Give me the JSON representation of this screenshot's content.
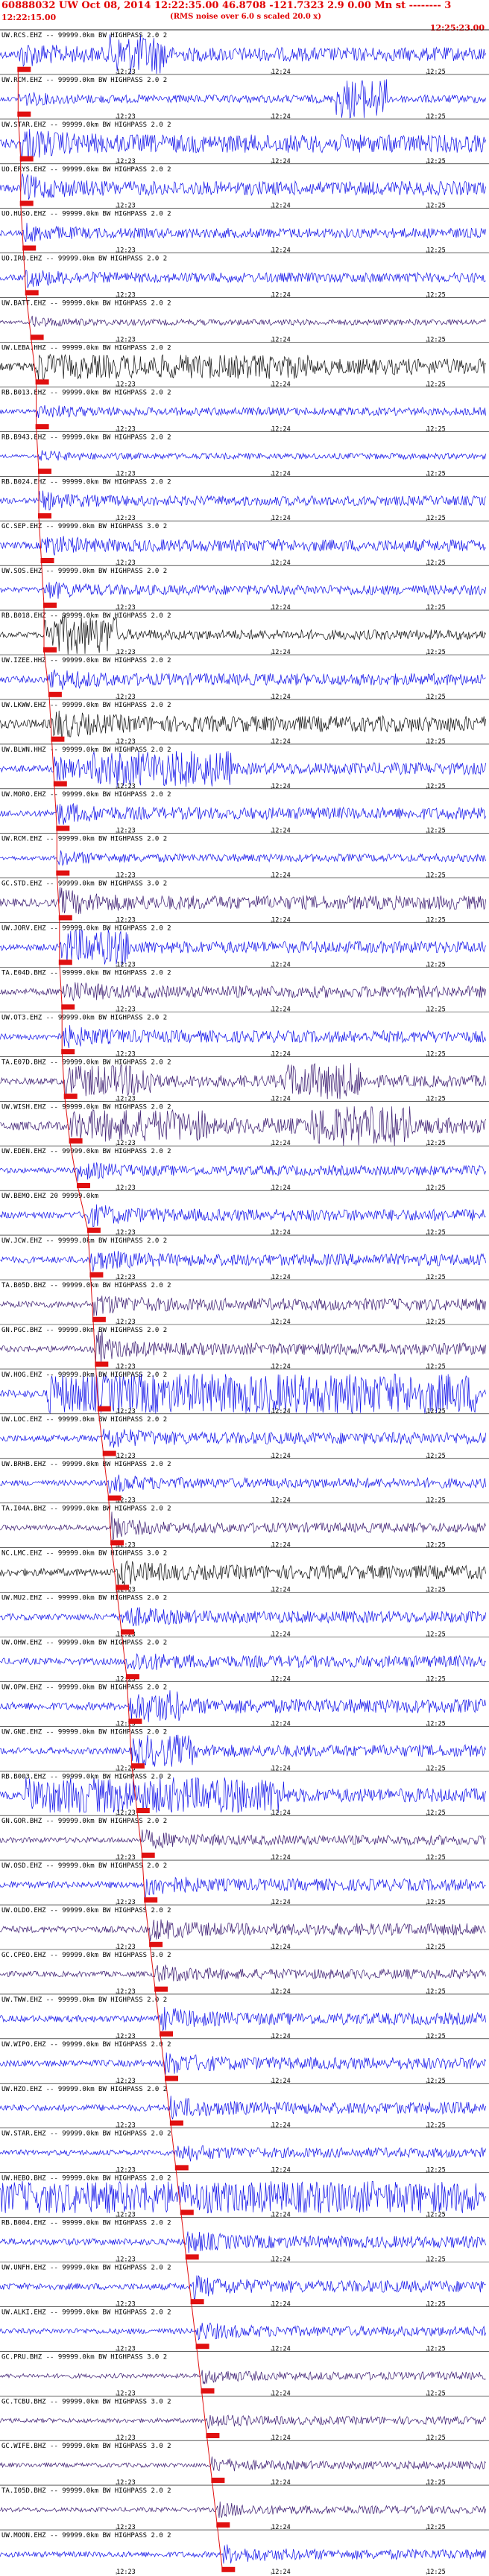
{
  "header": {
    "title": "60888032 UW Oct 08, 2014 12:22:35.00   46.8708 -121.7323  2.9 0.00 Mn st -------- 3",
    "start_time": "12:22:15.00",
    "note": "(RMS noise over 6.0 s scaled 20.0 x)",
    "end_time": "12:25:23.00"
  },
  "colors": {
    "blue": "#1010e8",
    "purple": "#3a1a70",
    "black": "#101010",
    "pick": "#e01010",
    "text": "#000000"
  },
  "chart_data": {
    "type": "line",
    "title": "60888032 UW Oct 08, 2014 12:22:35.00   46.8708 -121.7323  2.9 0.00 Mn st -------- 3",
    "x_label": "time",
    "x_start": "12:22:15.00",
    "x_end": "12:25:23.00",
    "time_ticks": [
      "12:23",
      "12:24",
      "12:25"
    ],
    "series": [
      {
        "name": "UW.RCS.EHZ -- 99999.0km BW  HIGHPASS  2.0  2",
        "color": "blue",
        "pick_s": 7,
        "amp": 0.35,
        "burst": [
          [
            42,
            65,
            1.0
          ]
        ]
      },
      {
        "name": "UW.RCM.EHZ -- 99999.0km BW  HIGHPASS  2.0  2",
        "color": "blue",
        "pick_s": 7,
        "amp": 0.2,
        "burst": [
          [
            130,
            150,
            1.0
          ]
        ]
      },
      {
        "name": "UW.STAR.EHZ -- 99999.0km BW  HIGHPASS  2.0  2",
        "color": "blue",
        "pick_s": 8,
        "amp": 0.45,
        "burst": []
      },
      {
        "name": "UO.ERYS.EHZ -- 99999.0km BW  HIGHPASS  2.0  2",
        "color": "blue",
        "pick_s": 8,
        "amp": 0.35,
        "burst": []
      },
      {
        "name": "UO.HUSO.EHZ -- 99999.0km BW  HIGHPASS  2.0  2",
        "color": "blue",
        "pick_s": 9,
        "amp": 0.25,
        "burst": []
      },
      {
        "name": "UO.IRO.EHZ -- 99999.0km BW  HIGHPASS  2.0  2",
        "color": "blue",
        "pick_s": 10,
        "amp": 0.25,
        "burst": []
      },
      {
        "name": "UW.BATT.EHZ -- 99999.0km BW  HIGHPASS  2.0  2",
        "color": "purple",
        "pick_s": 12,
        "amp": 0.15,
        "burst": []
      },
      {
        "name": "UW.LEBA.HHZ -- 99999.0km BW  HIGHPASS  2.0  2",
        "color": "black",
        "pick_s": 14,
        "amp": 0.4,
        "burst": [
          [
            15,
            120,
            0.6
          ]
        ]
      },
      {
        "name": "RB.B013.EHZ -- 99999.0km BW  HIGHPASS  2.0  2",
        "color": "blue",
        "pick_s": 14,
        "amp": 0.2,
        "burst": []
      },
      {
        "name": "RB.B943.EHZ -- 99999.0km BW  HIGHPASS  2.0  2",
        "color": "blue",
        "pick_s": 15,
        "amp": 0.15,
        "burst": []
      },
      {
        "name": "RB.B024.EHZ -- 99999.0km BW  HIGHPASS  2.0  2",
        "color": "blue",
        "pick_s": 15,
        "amp": 0.25,
        "burst": []
      },
      {
        "name": "GC.SEP.EHZ -- 99999.0km BW  HIGHPASS  3.0  2",
        "color": "blue",
        "pick_s": 16,
        "amp": 0.3,
        "burst": []
      },
      {
        "name": "UW.SOS.EHZ -- 99999.0km BW  HIGHPASS  2.0  2",
        "color": "blue",
        "pick_s": 17,
        "amp": 0.25,
        "burst": []
      },
      {
        "name": "RB.B018.EHZ -- 99999.0km BW  HIGHPASS  2.0  2",
        "color": "black",
        "pick_s": 17,
        "amp": 0.25,
        "burst": [
          [
            17,
            45,
            1.0
          ]
        ]
      },
      {
        "name": "UW.IZEE.HHZ -- 99999.0km BW  HIGHPASS  2.0  2",
        "color": "blue",
        "pick_s": 19,
        "amp": 0.3,
        "burst": []
      },
      {
        "name": "UW.LKWW.EHZ -- 99999.0km BW  HIGHPASS  2.0  2",
        "color": "black",
        "pick_s": 20,
        "amp": 0.4,
        "burst": []
      },
      {
        "name": "UW.BLWN.HHZ -- 99999.0km BW  HIGHPASS  2.0  2",
        "color": "blue",
        "pick_s": 21,
        "amp": 0.3,
        "burst": [
          [
            35,
            90,
            0.9
          ]
        ]
      },
      {
        "name": "UW.MORO.EHZ -- 99999.0km BW  HIGHPASS  2.0  2",
        "color": "blue",
        "pick_s": 22,
        "amp": 0.3,
        "burst": []
      },
      {
        "name": "UW.RCM.EHZ -- 99999.0km BW  HIGHPASS  2.0  2",
        "color": "blue",
        "pick_s": 22,
        "amp": 0.2,
        "burst": []
      },
      {
        "name": "GC.STD.EHZ -- 99999.0km BW  HIGHPASS  3.0  2",
        "color": "purple",
        "pick_s": 23,
        "amp": 0.35,
        "burst": []
      },
      {
        "name": "UW.JORV.EHZ -- 99999.0km BW  HIGHPASS  2.0  2",
        "color": "blue",
        "pick_s": 23,
        "amp": 0.3,
        "burst": [
          [
            25,
            50,
            0.9
          ]
        ]
      },
      {
        "name": "TA.E04D.BHZ -- 99999.0km BW  HIGHPASS  2.0  2",
        "color": "purple",
        "pick_s": 24,
        "amp": 0.3,
        "burst": []
      },
      {
        "name": "UW.OT3.EHZ -- 99999.0km BW  HIGHPASS  2.0  2",
        "color": "blue",
        "pick_s": 24,
        "amp": 0.3,
        "burst": []
      },
      {
        "name": "TA.E07D.BHZ -- 99999.0km BW  HIGHPASS  2.0  2",
        "color": "purple",
        "pick_s": 25,
        "amp": 0.3,
        "burst": [
          [
            25,
            60,
            0.8
          ],
          [
            110,
            140,
            0.9
          ]
        ]
      },
      {
        "name": "UW.WISH.EHZ -- 99999.0km BW  HIGHPASS  2.0  2",
        "color": "purple",
        "pick_s": 27,
        "amp": 0.4,
        "burst": [
          [
            35,
            80,
            0.8
          ],
          [
            120,
            160,
            1.0
          ]
        ]
      },
      {
        "name": "UW.EDEN.EHZ -- 99999.0km BW  HIGHPASS  2.0  2",
        "color": "blue",
        "pick_s": 30,
        "amp": 0.25,
        "burst": []
      },
      {
        "name": "UW.BEMO.EHZ 20 99999.0km",
        "color": "blue",
        "pick_s": 34,
        "amp": 0.3,
        "burst": []
      },
      {
        "name": "UW.JCW.EHZ -- 99999.0km BW  HIGHPASS  2.0  2",
        "color": "blue",
        "pick_s": 35,
        "amp": 0.3,
        "burst": []
      },
      {
        "name": "TA.B05D.BHZ -- 99999.0km BW  HIGHPASS  2.0  2",
        "color": "purple",
        "pick_s": 36,
        "amp": 0.3,
        "burst": []
      },
      {
        "name": "GN.PGC.BHZ -- 99999.0km BW  HIGHPASS  2.0  2",
        "color": "purple",
        "pick_s": 37,
        "amp": 0.3,
        "burst": [
          [
            37,
            40,
            1.0
          ]
        ]
      },
      {
        "name": "UW.HOG.EHZ -- 99999.0km BW  HIGHPASS  2.0  2",
        "color": "blue",
        "pick_s": 38,
        "amp": 0.35,
        "burst": [
          [
            18,
            185,
            1.0
          ]
        ]
      },
      {
        "name": "UW.LOC.EHZ -- 99999.0km BW  HIGHPASS  2.0  2",
        "color": "blue",
        "pick_s": 40,
        "amp": 0.3,
        "burst": []
      },
      {
        "name": "UW.BRHB.EHZ -- 99999.0km BW  HIGHPASS  2.0  2",
        "color": "blue",
        "pick_s": 42,
        "amp": 0.25,
        "burst": []
      },
      {
        "name": "TA.I04A.BHZ -- 99999.0km BW  HIGHPASS  2.0  2",
        "color": "purple",
        "pick_s": 43,
        "amp": 0.25,
        "burst": [
          [
            43,
            46,
            1.0
          ]
        ]
      },
      {
        "name": "NC.LMC.EHZ -- 99999.0km BW  HIGHPASS  3.0  2",
        "color": "black",
        "pick_s": 45,
        "amp": 0.35,
        "burst": []
      },
      {
        "name": "UW.MU2.EHZ -- 99999.0km BW  HIGHPASS  2.0  2",
        "color": "blue",
        "pick_s": 47,
        "amp": 0.3,
        "burst": []
      },
      {
        "name": "UW.OHW.EHZ -- 99999.0km BW  HIGHPASS  2.0  2",
        "color": "blue",
        "pick_s": 49,
        "amp": 0.3,
        "burst": []
      },
      {
        "name": "UW.OPW.EHZ -- 99999.0km BW  HIGHPASS  2.0  2",
        "color": "blue",
        "pick_s": 50,
        "amp": 0.35,
        "burst": [
          [
            50,
            70,
            0.8
          ]
        ]
      },
      {
        "name": "UW.GNE.EHZ -- 99999.0km BW  HIGHPASS  2.0  2",
        "color": "blue",
        "pick_s": 51,
        "amp": 0.3,
        "burst": [
          [
            51,
            75,
            0.8
          ]
        ]
      },
      {
        "name": "RB.B003.EHZ -- 99999.0km BW  HIGHPASS  2.0  2",
        "color": "blue",
        "pick_s": 53,
        "amp": 0.35,
        "burst": [
          [
            10,
            110,
            0.9
          ]
        ]
      },
      {
        "name": "GN.GOR.BHZ -- 99999.0km BW  HIGHPASS  2.0  2",
        "color": "purple",
        "pick_s": 55,
        "amp": 0.25,
        "burst": []
      },
      {
        "name": "UW.OSD.EHZ -- 99999.0km BW  HIGHPASS  2.0  2",
        "color": "blue",
        "pick_s": 56,
        "amp": 0.3,
        "burst": []
      },
      {
        "name": "UW.OLDO.EHZ -- 99999.0km BW  HIGHPASS  2.0  2",
        "color": "purple",
        "pick_s": 58,
        "amp": 0.3,
        "burst": []
      },
      {
        "name": "GC.CPEO.EHZ -- 99999.0km BW  HIGHPASS  3.0  2",
        "color": "purple",
        "pick_s": 60,
        "amp": 0.25,
        "burst": []
      },
      {
        "name": "UW.TWW.EHZ -- 99999.0km BW  HIGHPASS  2.0  2",
        "color": "blue",
        "pick_s": 62,
        "amp": 0.3,
        "burst": []
      },
      {
        "name": "UW.WIPO.EHZ -- 99999.0km BW  HIGHPASS  2.0  2",
        "color": "blue",
        "pick_s": 64,
        "amp": 0.3,
        "burst": []
      },
      {
        "name": "UW.HZO.EHZ -- 99999.0km BW  HIGHPASS  2.0  2",
        "color": "blue",
        "pick_s": 66,
        "amp": 0.3,
        "burst": []
      },
      {
        "name": "UW.STAR.EHZ -- 99999.0km BW  HIGHPASS  2.0  2",
        "color": "blue",
        "pick_s": 68,
        "amp": 0.25,
        "burst": []
      },
      {
        "name": "UW.HEBO.BHZ -- 99999.0km BW  HIGHPASS  2.0  2",
        "color": "blue",
        "pick_s": 70,
        "amp": 0.35,
        "burst": [
          [
            0,
            185,
            0.8
          ]
        ]
      },
      {
        "name": "RB.B004.EHZ -- 99999.0km BW  HIGHPASS  2.0  2",
        "color": "blue",
        "pick_s": 72,
        "amp": 0.3,
        "burst": []
      },
      {
        "name": "UW.UNFH.EHZ -- 99999.0km BW  HIGHPASS  2.0  2",
        "color": "blue",
        "pick_s": 74,
        "amp": 0.3,
        "burst": []
      },
      {
        "name": "UW.ALKI.EHZ -- 99999.0km BW  HIGHPASS  2.0  2",
        "color": "blue",
        "pick_s": 76,
        "amp": 0.25,
        "burst": []
      },
      {
        "name": "GC.PRU.BHZ -- 99999.0km BW  HIGHPASS  3.0  2",
        "color": "purple",
        "pick_s": 78,
        "amp": 0.2,
        "burst": []
      },
      {
        "name": "GC.TCBU.BHZ -- 99999.0km BW  HIGHPASS  3.0  2",
        "color": "purple",
        "pick_s": 80,
        "amp": 0.2,
        "burst": []
      },
      {
        "name": "GC.WIFE.BHZ -- 99999.0km BW  HIGHPASS  3.0  2",
        "color": "purple",
        "pick_s": 82,
        "amp": 0.2,
        "burst": []
      },
      {
        "name": "TA.I05D.BHZ -- 99999.0km BW  HIGHPASS  2.0  2",
        "color": "purple",
        "pick_s": 84,
        "amp": 0.2,
        "burst": []
      },
      {
        "name": "UW.MOON.EHZ -- 99999.0km BW  HIGHPASS  2.0  2",
        "color": "blue",
        "pick_s": 86,
        "amp": 0.25,
        "burst": []
      }
    ]
  }
}
